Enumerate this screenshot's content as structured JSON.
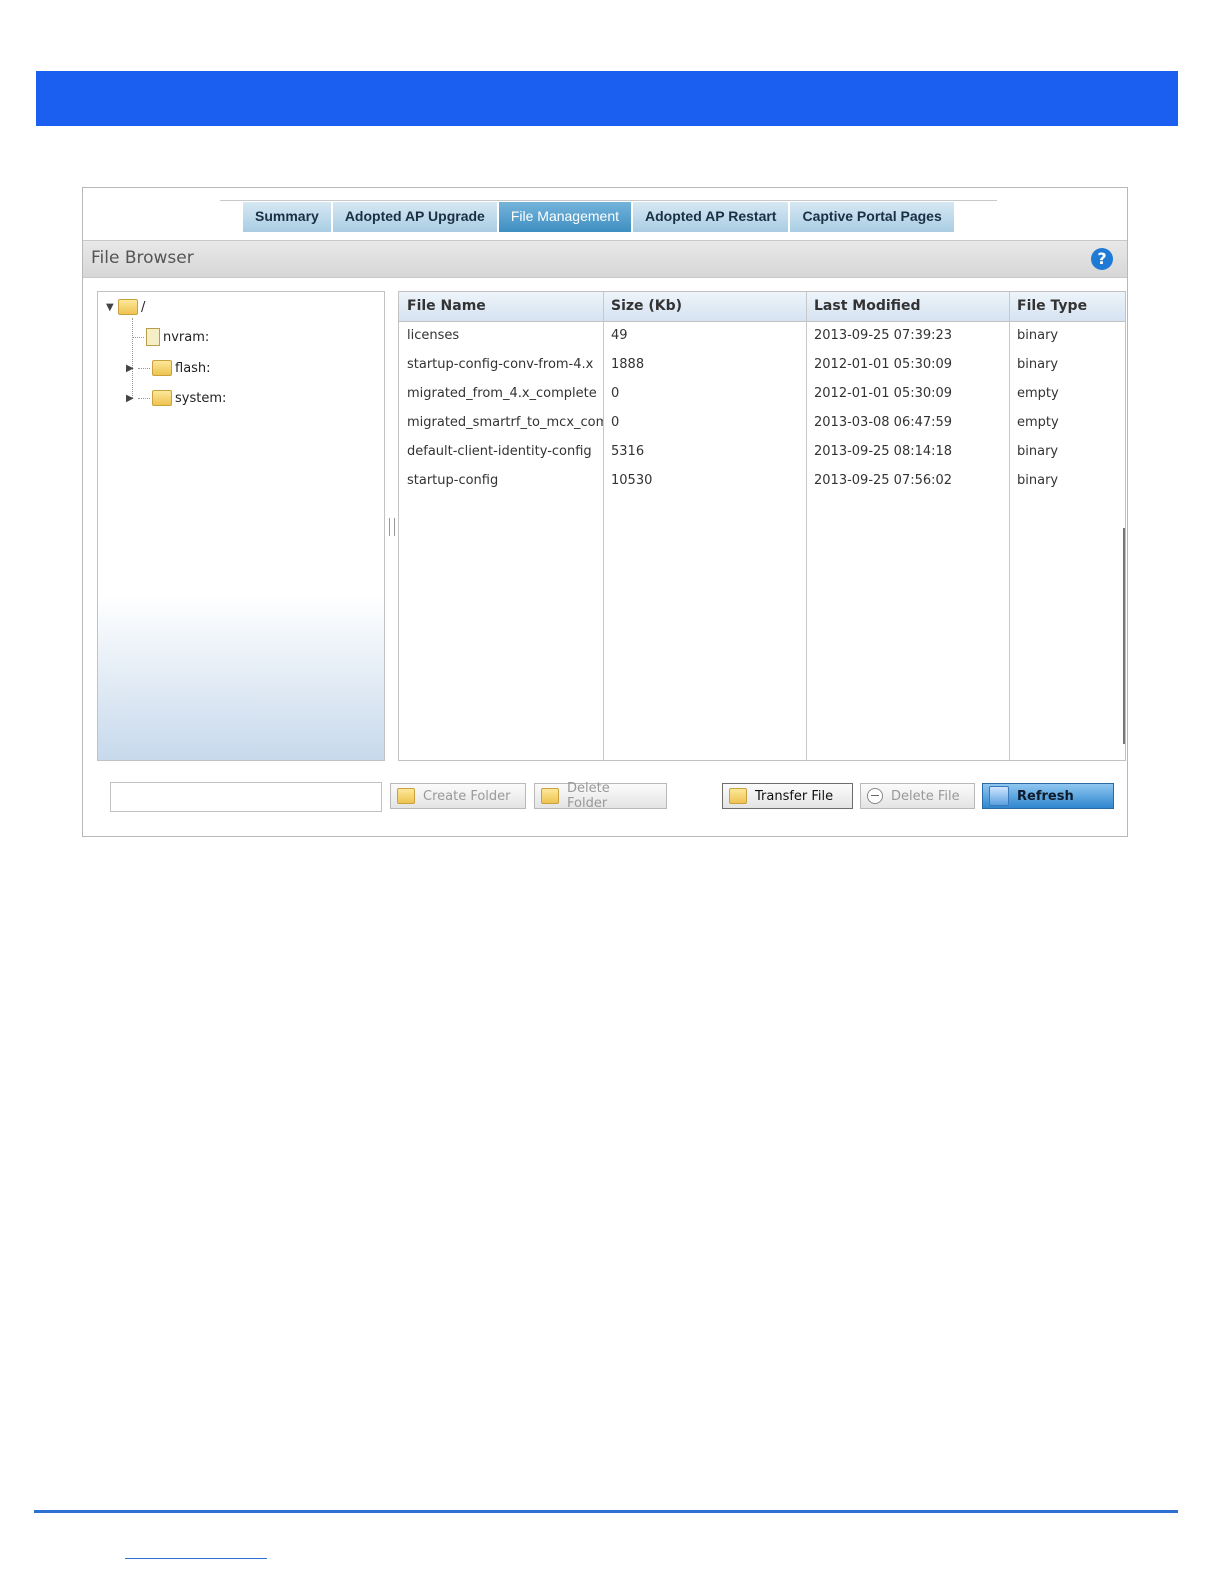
{
  "tabs": [
    {
      "label": "Summary",
      "active": false
    },
    {
      "label": "Adopted AP Upgrade",
      "active": false
    },
    {
      "label": "File Management",
      "active": true
    },
    {
      "label": "Adopted AP Restart",
      "active": false
    },
    {
      "label": "Captive Portal Pages",
      "active": false
    }
  ],
  "section": {
    "title": "File Browser",
    "help_icon": "?"
  },
  "tree": {
    "root": "/",
    "children": [
      "nvram:",
      "flash:",
      "system:"
    ]
  },
  "table": {
    "columns": [
      "File Name",
      "Size (Kb)",
      "Last Modified",
      "File Type"
    ],
    "rows": [
      [
        "licenses",
        "49",
        "2013-09-25 07:39:23",
        "binary"
      ],
      [
        "startup-config-conv-from-4.x",
        "1888",
        "2012-01-01 05:30:09",
        "binary"
      ],
      [
        "migrated_from_4.x_complete",
        "0",
        "2012-01-01 05:30:09",
        "empty"
      ],
      [
        "migrated_smartrf_to_mcx_comp",
        "0",
        "2013-03-08 06:47:59",
        "empty"
      ],
      [
        "default-client-identity-config",
        "5316",
        "2013-09-25 08:14:18",
        "binary"
      ],
      [
        "startup-config",
        "10530",
        "2013-09-25 07:56:02",
        "binary"
      ]
    ]
  },
  "buttons": {
    "create_folder": "Create Folder",
    "delete_folder": "Delete Folder",
    "transfer_file": "Transfer File",
    "delete_file": "Delete File",
    "refresh": "Refresh"
  },
  "colors": {
    "header_band": "#1a5ff0",
    "active_tab": "#3f8fc2",
    "rule": "#2e6fd4"
  }
}
